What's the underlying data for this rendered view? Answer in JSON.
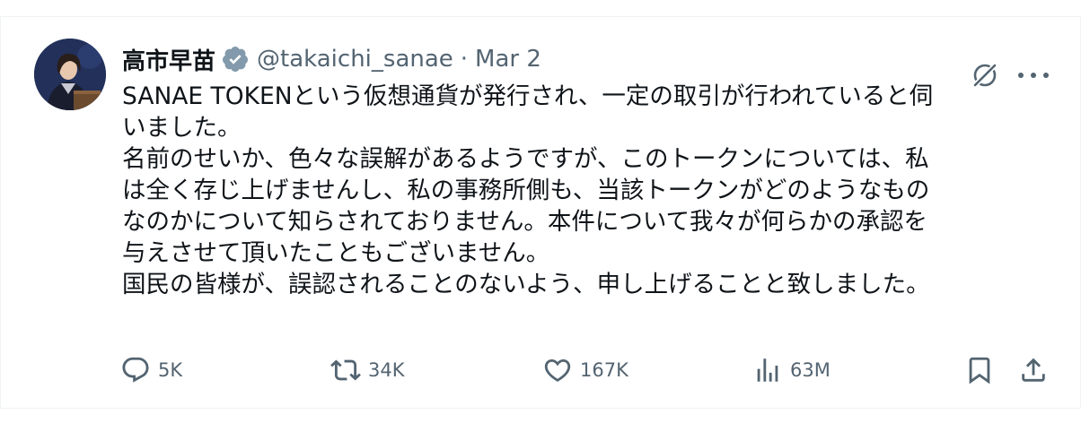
{
  "tweet": {
    "author_name": "高市早苗",
    "handle": "@takaichi_sanae",
    "separator": "·",
    "date": "Mar 2",
    "lines": [
      "SANAE TOKENという仮想通貨が発行され、一定の取引が行われていると伺",
      "いました。",
      "名前のせいか、色々な誤解があるようですが、このトークンについては、私",
      "は全く存じ上げませんし、私の事務所側も、当該トークンがどのようなもの",
      "なのかについて知らされておりません。本件について我々が何らかの承認を",
      "与えさせて頂いたこともございません。",
      "国民の皆様が、誤認されることのないよう、申し上げることと致しました。"
    ],
    "stats": {
      "replies": "5K",
      "retweets": "34K",
      "likes": "167K",
      "views": "63M"
    }
  },
  "icons": {
    "verified": "verified-badge-icon",
    "grok": "grok-icon",
    "more": "more-icon",
    "reply": "reply-icon",
    "retweet": "retweet-icon",
    "like": "heart-icon",
    "views": "views-icon",
    "bookmark": "bookmark-icon",
    "share": "share-icon"
  },
  "colors": {
    "text": "#0f1419",
    "secondary": "#536471",
    "border": "#eff3f4"
  }
}
